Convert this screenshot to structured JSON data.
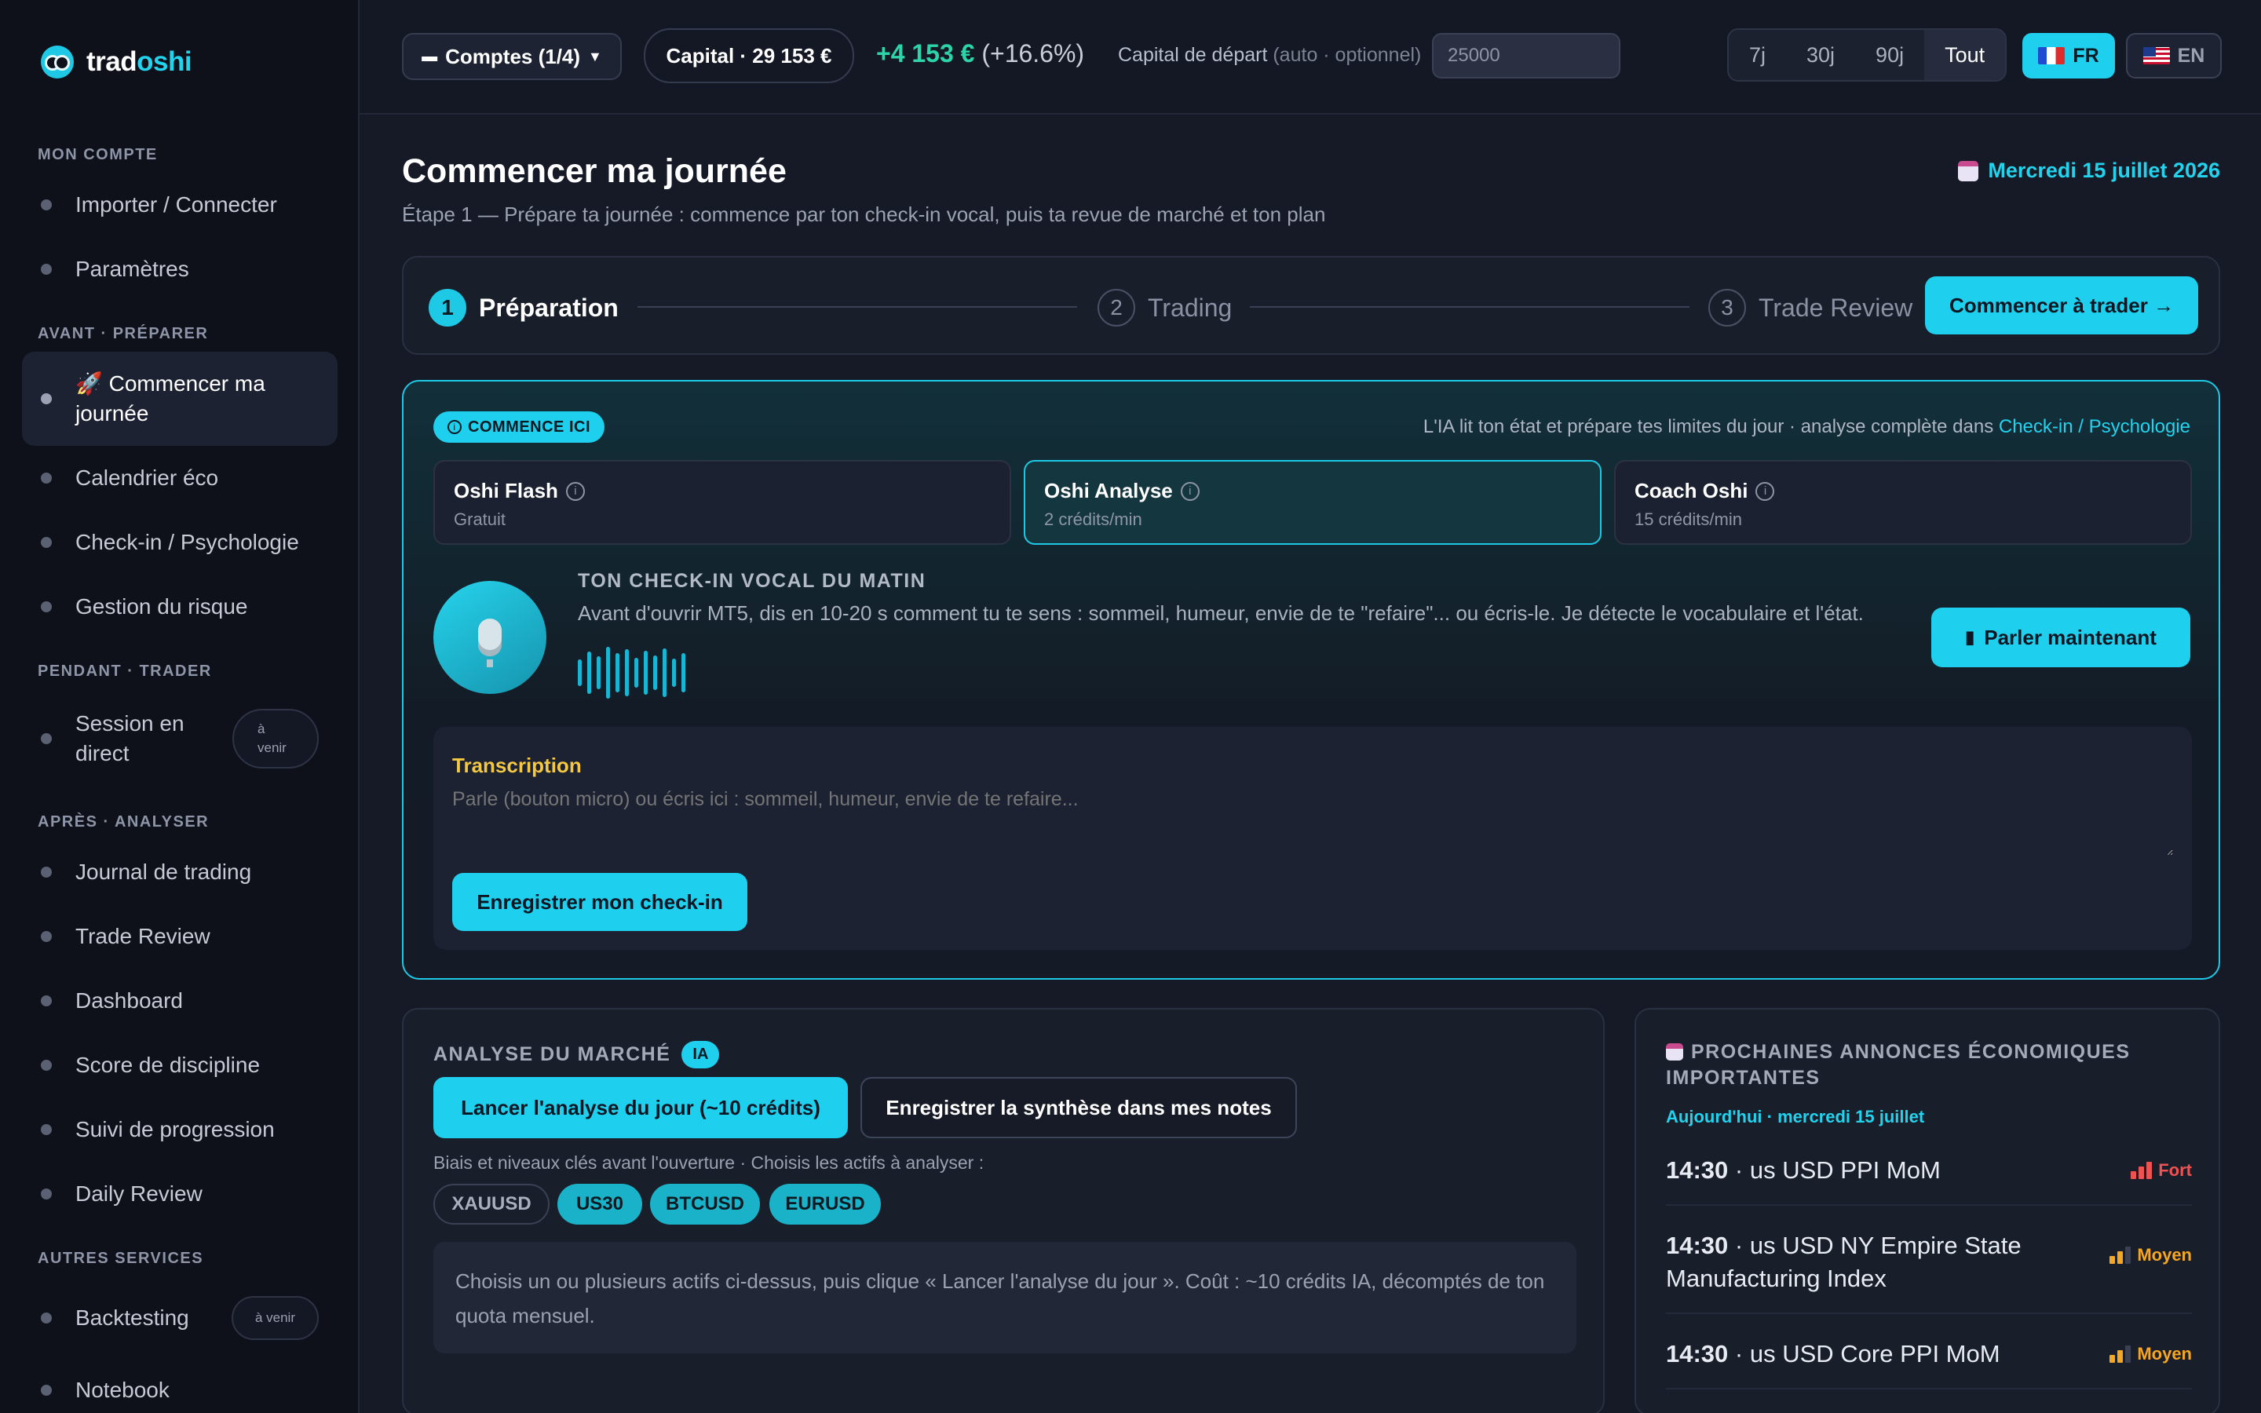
{
  "brand": {
    "name_a": "trad",
    "name_b": "oshi"
  },
  "sidebar": {
    "sections": [
      {
        "title": "MON COMPTE"
      },
      {
        "title": "AVANT · PRÉPARER"
      },
      {
        "title": "PENDANT · TRADER"
      },
      {
        "title": "APRÈS · ANALYSER"
      },
      {
        "title": "AUTRES SERVICES"
      }
    ],
    "items": [
      {
        "label": "Importer / Connecter"
      },
      {
        "label": "Paramètres"
      },
      {
        "label": "🚀 Commencer ma journée"
      },
      {
        "label": "Calendrier éco"
      },
      {
        "label": "Check-in / Psychologie"
      },
      {
        "label": "Gestion du risque"
      },
      {
        "label": "Session en direct",
        "badge": "à venir"
      },
      {
        "label": "Journal de trading"
      },
      {
        "label": "Trade Review"
      },
      {
        "label": "Dashboard"
      },
      {
        "label": "Score de discipline"
      },
      {
        "label": "Suivi de progression"
      },
      {
        "label": "Daily Review"
      },
      {
        "label": "Backtesting",
        "badge": "à venir"
      },
      {
        "label": "Notebook"
      }
    ]
  },
  "topbar": {
    "accounts": "Comptes (1/4)",
    "capital": "Capital · 29 153 €",
    "gain": "+4 153 €",
    "gain_pct": "(+16.6%)",
    "start_label": "Capital de départ",
    "start_hint": "(auto · optionnel)",
    "start_value": "25000",
    "periods": [
      "7j",
      "30j",
      "90j",
      "Tout"
    ],
    "selected_period": "Tout",
    "lang_fr": "FR",
    "lang_en": "EN"
  },
  "page": {
    "title": "Commencer ma journée",
    "subtitle": "Étape 1 — Prépare ta journée : commence par ton check-in vocal, puis ta revue de marché et ton plan",
    "date": "Mercredi 15 juillet 2026"
  },
  "steps": [
    {
      "num": "1",
      "label": "Préparation"
    },
    {
      "num": "2",
      "label": "Trading"
    },
    {
      "num": "3",
      "label": "Trade Review"
    }
  ],
  "start_trading": "Commencer à trader →",
  "checkin": {
    "badge": "COMMENCE ICI",
    "note": "L'IA lit ton état et prépare tes limites du jour · analyse complète dans",
    "note_link": "Check-in / Psychologie",
    "modes": [
      {
        "title": "Oshi Flash",
        "sub": "Gratuit"
      },
      {
        "title": "Oshi Analyse",
        "sub": "2 crédits/min"
      },
      {
        "title": "Coach Oshi",
        "sub": "15 crédits/min"
      }
    ],
    "heading": "TON CHECK-IN VOCAL DU MATIN",
    "text": "Avant d'ouvrir MT5, dis en 10-20 s comment tu te sens : sommeil, humeur, envie de te \"refaire\"... ou écris-le. Je détecte le vocabulaire et l'état.",
    "speak": "Parler maintenant",
    "transcription_title": "Transcription",
    "placeholder": "Parle (bouton micro) ou écris ici : sommeil, humeur, envie de te refaire...",
    "save": "Enregistrer mon check-in"
  },
  "market": {
    "title": "ANALYSE DU MARCHÉ",
    "badge": "IA",
    "launch": "Lancer l'analyse du jour (~10 crédits)",
    "save_notes": "Enregistrer la synthèse dans mes notes",
    "assets_label": "Biais et niveaux clés avant l'ouverture · Choisis les actifs à analyser :",
    "assets": [
      {
        "name": "XAUUSD",
        "selected": false
      },
      {
        "name": "US30",
        "selected": true
      },
      {
        "name": "BTCUSD",
        "selected": true
      },
      {
        "name": "EURUSD",
        "selected": true
      }
    ],
    "info": "Choisis un ou plusieurs actifs ci-dessus, puis clique « Lancer l'analyse du jour ». Coût : ~10 crédits IA, décomptés de ton quota mensuel."
  },
  "eco": {
    "title": "PROCHAINES ANNONCES ÉCONOMIQUES IMPORTANTES",
    "day": "Aujourd'hui · mercredi 15 juillet",
    "events": [
      {
        "time": "14:30",
        "country": "us",
        "name": "USD PPI MoM",
        "impact": "Fort",
        "level": 3,
        "color": "#f05252"
      },
      {
        "time": "14:30",
        "country": "us",
        "name": "USD NY Empire State Manufacturing Index",
        "impact": "Moyen",
        "level": 2,
        "color": "#f5a623"
      },
      {
        "time": "14:30",
        "country": "us",
        "name": "USD Core PPI MoM",
        "impact": "Moyen",
        "level": 2,
        "color": "#f5a623"
      }
    ]
  },
  "colors": {
    "accent": "#1ed0ee",
    "positive": "#2dd4a8",
    "warning": "#f5c842"
  }
}
